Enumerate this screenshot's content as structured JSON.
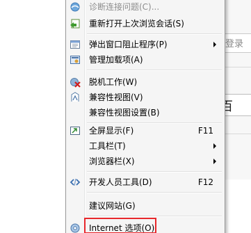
{
  "background": {
    "search_field_text": "登录",
    "baidu_button_text": "百"
  },
  "menu": {
    "items": [
      {
        "label": "诊断连接问题(C)...",
        "shortcut": "",
        "submenu": false,
        "disabled": true,
        "icon": "diagnose-icon"
      },
      {
        "label": "重新打开上次浏览会话(S)",
        "shortcut": "",
        "submenu": false,
        "disabled": false,
        "icon": "reopen-session-icon"
      },
      {
        "label": "弹出窗口阻止程序(P)",
        "shortcut": "",
        "submenu": true,
        "disabled": false,
        "icon": "popup-blocker-icon"
      },
      {
        "label": "管理加载项(A)",
        "shortcut": "",
        "submenu": false,
        "disabled": false,
        "icon": "manage-addons-icon"
      },
      {
        "label": "脱机工作(W)",
        "shortcut": "",
        "submenu": false,
        "disabled": false,
        "icon": "work-offline-icon"
      },
      {
        "label": "兼容性视图(V)",
        "shortcut": "",
        "submenu": false,
        "disabled": false,
        "icon": "compat-view-icon"
      },
      {
        "label": "兼容性视图设置(B)",
        "shortcut": "",
        "submenu": false,
        "disabled": false,
        "icon": ""
      },
      {
        "label": "全屏显示(F)",
        "shortcut": "F11",
        "submenu": false,
        "disabled": false,
        "icon": "fullscreen-icon"
      },
      {
        "label": "工具栏(T)",
        "shortcut": "",
        "submenu": true,
        "disabled": false,
        "icon": ""
      },
      {
        "label": "浏览器栏(X)",
        "shortcut": "",
        "submenu": true,
        "disabled": false,
        "icon": ""
      },
      {
        "label": "开发人员工具(D)",
        "shortcut": "F12",
        "submenu": false,
        "disabled": false,
        "icon": "developer-tools-icon"
      },
      {
        "label": "建议网站(G)",
        "shortcut": "",
        "submenu": false,
        "disabled": false,
        "icon": ""
      },
      {
        "label": "Internet 选项(O)",
        "shortcut": "",
        "submenu": false,
        "disabled": false,
        "icon": "internet-options-icon"
      }
    ]
  },
  "colors": {
    "highlight_border": "#e8282c",
    "menu_background": "#f5f5f5"
  }
}
